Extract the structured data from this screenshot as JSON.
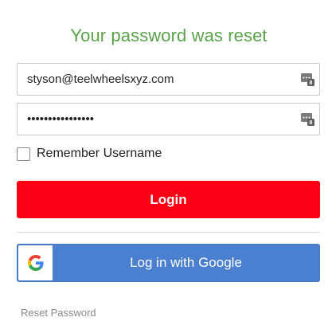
{
  "title": "Your password was reset",
  "email_field": {
    "value": "styson@teelwheelsxyz.com",
    "icon": "password-manager-icon"
  },
  "password_field": {
    "value": "••••••••••••••••",
    "icon": "password-manager-icon"
  },
  "remember": {
    "label": "Remember Username",
    "checked": false
  },
  "login_button": {
    "label": "Login"
  },
  "google_button": {
    "label": "Log in with Google",
    "icon": "google-g-icon"
  },
  "reset_link": {
    "label": "Reset Password"
  },
  "colors": {
    "title": "#5aa24a",
    "login": "#fb0015",
    "google": "#4b7fcf",
    "link": "#8a8a8a"
  }
}
